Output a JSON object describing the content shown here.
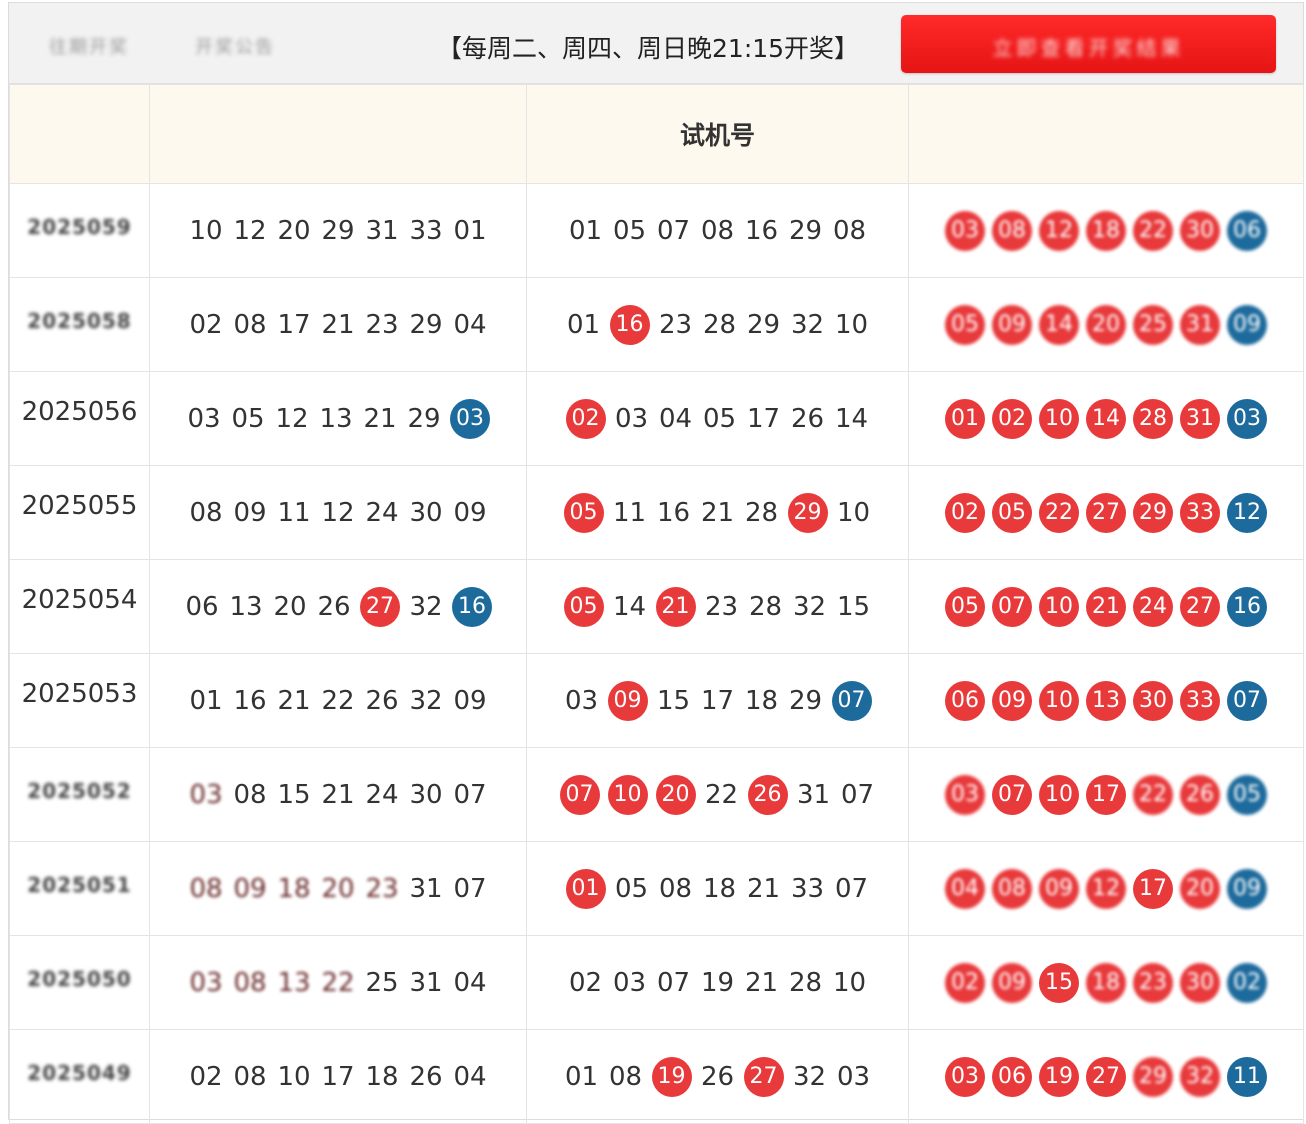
{
  "header": {
    "left_blur_1": "往期开奖",
    "left_blur_2": "开奖公告",
    "notice": "【每周二、周四、周日晚21:15开奖】",
    "red_button_label": "立即查看开奖结果"
  },
  "table": {
    "columns": [
      "",
      "",
      "试机号",
      ""
    ],
    "rows": [
      {
        "issue": "2025059",
        "issue_blurred": true,
        "draw": [
          {
            "n": "10"
          },
          {
            "n": "12"
          },
          {
            "n": "20"
          },
          {
            "n": "29"
          },
          {
            "n": "31"
          },
          {
            "n": "33"
          },
          {
            "n": "01"
          }
        ],
        "test": [
          {
            "n": "01"
          },
          {
            "n": "05"
          },
          {
            "n": "07"
          },
          {
            "n": "08"
          },
          {
            "n": "16"
          },
          {
            "n": "29"
          },
          {
            "n": "08"
          }
        ],
        "pred": [
          {
            "n": "03",
            "c": "red",
            "b": true
          },
          {
            "n": "08",
            "c": "red",
            "b": true
          },
          {
            "n": "12",
            "c": "red",
            "b": true
          },
          {
            "n": "18",
            "c": "red",
            "b": true
          },
          {
            "n": "22",
            "c": "red",
            "b": true
          },
          {
            "n": "30",
            "c": "red",
            "b": true
          },
          {
            "n": "06",
            "c": "blue",
            "b": true
          }
        ]
      },
      {
        "issue": "2025058",
        "issue_blurred": true,
        "draw": [
          {
            "n": "02"
          },
          {
            "n": "08"
          },
          {
            "n": "17"
          },
          {
            "n": "21"
          },
          {
            "n": "23"
          },
          {
            "n": "29"
          },
          {
            "n": "04"
          }
        ],
        "test": [
          {
            "n": "01"
          },
          {
            "n": "16",
            "c": "red"
          },
          {
            "n": "23"
          },
          {
            "n": "28"
          },
          {
            "n": "29"
          },
          {
            "n": "32"
          },
          {
            "n": "10"
          }
        ],
        "pred": [
          {
            "n": "05",
            "c": "red",
            "b": true
          },
          {
            "n": "09",
            "c": "red",
            "b": true
          },
          {
            "n": "14",
            "c": "red",
            "b": true
          },
          {
            "n": "20",
            "c": "red",
            "b": true
          },
          {
            "n": "25",
            "c": "red",
            "b": true
          },
          {
            "n": "31",
            "c": "red",
            "b": true
          },
          {
            "n": "09",
            "c": "blue",
            "b": true
          }
        ]
      },
      {
        "issue": "2025056",
        "draw": [
          {
            "n": "03"
          },
          {
            "n": "05"
          },
          {
            "n": "12"
          },
          {
            "n": "13"
          },
          {
            "n": "21"
          },
          {
            "n": "29"
          },
          {
            "n": "03",
            "c": "blue"
          }
        ],
        "test": [
          {
            "n": "02",
            "c": "red"
          },
          {
            "n": "03"
          },
          {
            "n": "04"
          },
          {
            "n": "05"
          },
          {
            "n": "17"
          },
          {
            "n": "26"
          },
          {
            "n": "14"
          }
        ],
        "pred": [
          {
            "n": "01",
            "c": "red"
          },
          {
            "n": "02",
            "c": "red"
          },
          {
            "n": "10",
            "c": "red"
          },
          {
            "n": "14",
            "c": "red"
          },
          {
            "n": "28",
            "c": "red"
          },
          {
            "n": "31",
            "c": "red"
          },
          {
            "n": "03",
            "c": "blue"
          }
        ]
      },
      {
        "issue": "2025055",
        "draw": [
          {
            "n": "08"
          },
          {
            "n": "09"
          },
          {
            "n": "11"
          },
          {
            "n": "12"
          },
          {
            "n": "24"
          },
          {
            "n": "30"
          },
          {
            "n": "09"
          }
        ],
        "test": [
          {
            "n": "05",
            "c": "red"
          },
          {
            "n": "11"
          },
          {
            "n": "16"
          },
          {
            "n": "21"
          },
          {
            "n": "28"
          },
          {
            "n": "29",
            "c": "red"
          },
          {
            "n": "10"
          }
        ],
        "pred": [
          {
            "n": "02",
            "c": "red"
          },
          {
            "n": "05",
            "c": "red"
          },
          {
            "n": "22",
            "c": "red"
          },
          {
            "n": "27",
            "c": "red"
          },
          {
            "n": "29",
            "c": "red"
          },
          {
            "n": "33",
            "c": "red"
          },
          {
            "n": "12",
            "c": "blue"
          }
        ]
      },
      {
        "issue": "2025054",
        "draw": [
          {
            "n": "06"
          },
          {
            "n": "13"
          },
          {
            "n": "20"
          },
          {
            "n": "26"
          },
          {
            "n": "27",
            "c": "red"
          },
          {
            "n": "32"
          },
          {
            "n": "16",
            "c": "blue"
          }
        ],
        "test": [
          {
            "n": "05",
            "c": "red"
          },
          {
            "n": "14"
          },
          {
            "n": "21",
            "c": "red"
          },
          {
            "n": "23"
          },
          {
            "n": "28"
          },
          {
            "n": "32"
          },
          {
            "n": "15"
          }
        ],
        "pred": [
          {
            "n": "05",
            "c": "red"
          },
          {
            "n": "07",
            "c": "red"
          },
          {
            "n": "10",
            "c": "red"
          },
          {
            "n": "21",
            "c": "red"
          },
          {
            "n": "24",
            "c": "red"
          },
          {
            "n": "27",
            "c": "red"
          },
          {
            "n": "16",
            "c": "blue"
          }
        ]
      },
      {
        "issue": "2025053",
        "draw": [
          {
            "n": "01"
          },
          {
            "n": "16"
          },
          {
            "n": "21"
          },
          {
            "n": "22"
          },
          {
            "n": "26"
          },
          {
            "n": "32"
          },
          {
            "n": "09"
          }
        ],
        "test": [
          {
            "n": "03"
          },
          {
            "n": "09",
            "c": "red"
          },
          {
            "n": "15"
          },
          {
            "n": "17"
          },
          {
            "n": "18"
          },
          {
            "n": "29"
          },
          {
            "n": "07",
            "c": "blue"
          }
        ],
        "pred": [
          {
            "n": "06",
            "c": "red"
          },
          {
            "n": "09",
            "c": "red"
          },
          {
            "n": "10",
            "c": "red"
          },
          {
            "n": "13",
            "c": "red"
          },
          {
            "n": "30",
            "c": "red"
          },
          {
            "n": "33",
            "c": "red"
          },
          {
            "n": "07",
            "c": "blue"
          }
        ]
      },
      {
        "issue": "2025052",
        "issue_blurred": true,
        "draw": [
          {
            "n": "03",
            "b": true
          },
          {
            "n": "08"
          },
          {
            "n": "15"
          },
          {
            "n": "21"
          },
          {
            "n": "24"
          },
          {
            "n": "30"
          },
          {
            "n": "07"
          }
        ],
        "test": [
          {
            "n": "07",
            "c": "red"
          },
          {
            "n": "10",
            "c": "red"
          },
          {
            "n": "20",
            "c": "red"
          },
          {
            "n": "22"
          },
          {
            "n": "26",
            "c": "red"
          },
          {
            "n": "31"
          },
          {
            "n": "07"
          }
        ],
        "pred": [
          {
            "n": "03",
            "c": "red",
            "b": true
          },
          {
            "n": "07",
            "c": "red"
          },
          {
            "n": "10",
            "c": "red"
          },
          {
            "n": "17",
            "c": "red"
          },
          {
            "n": "22",
            "c": "red",
            "b": true
          },
          {
            "n": "26",
            "c": "red",
            "b": true
          },
          {
            "n": "05",
            "c": "blue",
            "b": true
          }
        ]
      },
      {
        "issue": "2025051",
        "issue_blurred": true,
        "draw": [
          {
            "n": "08",
            "b": true
          },
          {
            "n": "09",
            "b": true
          },
          {
            "n": "18",
            "b": true
          },
          {
            "n": "20",
            "b": true
          },
          {
            "n": "23",
            "b": true
          },
          {
            "n": "31"
          },
          {
            "n": "07"
          }
        ],
        "test": [
          {
            "n": "01",
            "c": "red"
          },
          {
            "n": "05"
          },
          {
            "n": "08"
          },
          {
            "n": "18"
          },
          {
            "n": "21"
          },
          {
            "n": "33"
          },
          {
            "n": "07"
          }
        ],
        "pred": [
          {
            "n": "04",
            "c": "red",
            "b": true
          },
          {
            "n": "08",
            "c": "red",
            "b": true
          },
          {
            "n": "09",
            "c": "red",
            "b": true
          },
          {
            "n": "12",
            "c": "red",
            "b": true
          },
          {
            "n": "17",
            "c": "red"
          },
          {
            "n": "20",
            "c": "red",
            "b": true
          },
          {
            "n": "09",
            "c": "blue",
            "b": true
          }
        ]
      },
      {
        "issue": "2025050",
        "issue_blurred": true,
        "draw": [
          {
            "n": "03",
            "b": true
          },
          {
            "n": "08",
            "b": true
          },
          {
            "n": "13",
            "b": true
          },
          {
            "n": "22",
            "b": true
          },
          {
            "n": "25"
          },
          {
            "n": "31"
          },
          {
            "n": "04"
          }
        ],
        "test": [
          {
            "n": "02"
          },
          {
            "n": "03"
          },
          {
            "n": "07"
          },
          {
            "n": "19"
          },
          {
            "n": "21"
          },
          {
            "n": "28"
          },
          {
            "n": "10"
          }
        ],
        "pred": [
          {
            "n": "02",
            "c": "red",
            "b": true
          },
          {
            "n": "09",
            "c": "red",
            "b": true
          },
          {
            "n": "15",
            "c": "red"
          },
          {
            "n": "18",
            "c": "red",
            "b": true
          },
          {
            "n": "23",
            "c": "red",
            "b": true
          },
          {
            "n": "30",
            "c": "red",
            "b": true
          },
          {
            "n": "02",
            "c": "blue",
            "b": true
          }
        ]
      },
      {
        "issue": "2025049",
        "issue_blurred": true,
        "draw": [
          {
            "n": "02"
          },
          {
            "n": "08"
          },
          {
            "n": "10"
          },
          {
            "n": "17"
          },
          {
            "n": "18"
          },
          {
            "n": "26"
          },
          {
            "n": "04"
          }
        ],
        "test": [
          {
            "n": "01"
          },
          {
            "n": "08"
          },
          {
            "n": "19",
            "c": "red"
          },
          {
            "n": "26"
          },
          {
            "n": "27",
            "c": "red"
          },
          {
            "n": "32"
          },
          {
            "n": "03"
          }
        ],
        "pred": [
          {
            "n": "03",
            "c": "red"
          },
          {
            "n": "06",
            "c": "red"
          },
          {
            "n": "19",
            "c": "red"
          },
          {
            "n": "27",
            "c": "red"
          },
          {
            "n": "29",
            "c": "red",
            "b": true
          },
          {
            "n": "32",
            "c": "red",
            "b": true
          },
          {
            "n": "11",
            "c": "blue"
          }
        ]
      }
    ]
  },
  "colors": {
    "red_ball": "#e8393b",
    "blue_ball": "#1d6a9c",
    "header_bg": "#fdf9ef",
    "topbar_bg": "#f2f2f2",
    "red_button": "#e61414"
  }
}
